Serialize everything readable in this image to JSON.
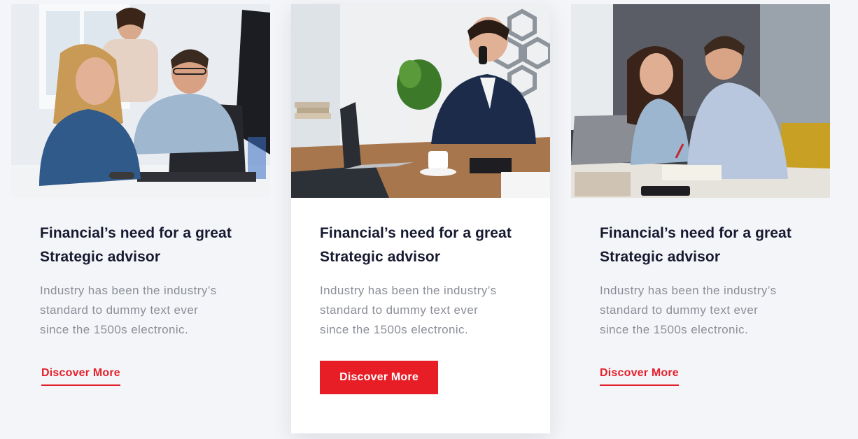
{
  "cards": [
    {
      "image": "office-team-laughing-at-computer-photo",
      "title_line1": "Financial’s need for a great",
      "title_line2": "Strategic advisor",
      "desc_line1": "Industry has been the industry’s",
      "desc_line2": "standard to dummy text ever",
      "desc_line3": "since the 1500s electronic.",
      "button_label": "Discover More",
      "button_style": "underline-link"
    },
    {
      "image": "businessman-on-phone-at-desk-photo",
      "title_line1": "Financial’s need for a great",
      "title_line2": "Strategic advisor",
      "desc_line1": "Industry has been the industry’s",
      "desc_line2": "standard to dummy text ever",
      "desc_line3": "since the 1500s electronic.",
      "button_label": "Discover More",
      "button_style": "solid"
    },
    {
      "image": "two-colleagues-working-with-laptop-photo",
      "title_line1": "Financial’s need for a great",
      "title_line2": "Strategic advisor",
      "desc_line1": "Industry has been the industry’s",
      "desc_line2": "standard to dummy text ever",
      "desc_line3": "since the 1500s electronic.",
      "button_label": "Discover More",
      "button_style": "underline-link"
    }
  ],
  "colors": {
    "accent": "#e81e27",
    "title": "#16192f",
    "body_text": "#8b8e98",
    "background": "#f4f5f8"
  }
}
